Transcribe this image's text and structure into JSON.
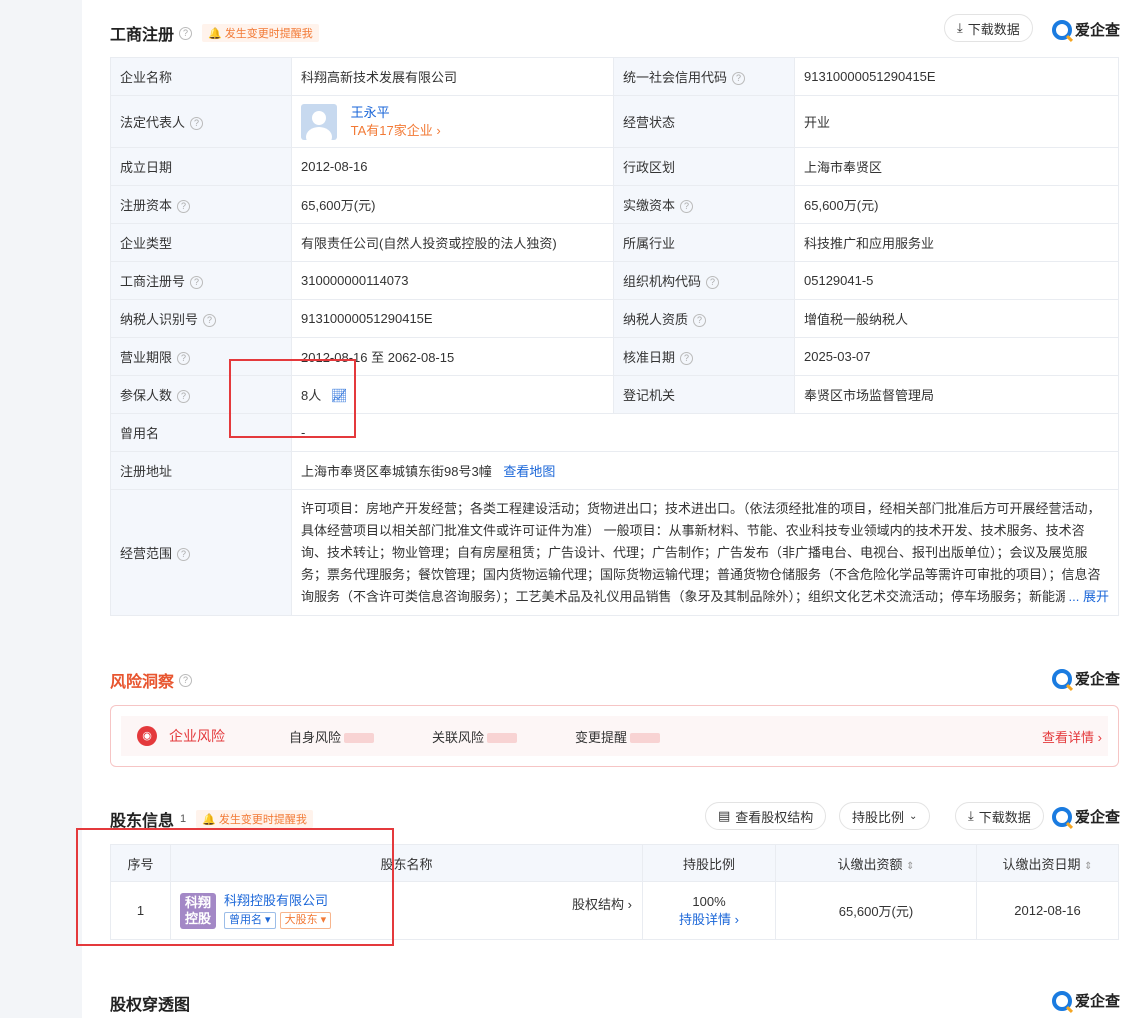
{
  "registration": {
    "title": "工商注册",
    "remind": "发生变更时提醒我",
    "download": "下载数据",
    "brand": "爱企查",
    "rows": {
      "company_name_label": "企业名称",
      "company_name": "科翔高新技术发展有限公司",
      "credit_code_label": "统一社会信用代码",
      "credit_code": "91310000051290415E",
      "legal_rep_label": "法定代表人",
      "legal_rep_name": "王永平",
      "legal_rep_link": "TA有17家企业 ›",
      "status_label": "经营状态",
      "status": "开业",
      "founded_label": "成立日期",
      "founded": "2012-08-16",
      "district_label": "行政区划",
      "district": "上海市奉贤区",
      "reg_capital_label": "注册资本",
      "reg_capital": "65,600万(元)",
      "paid_capital_label": "实缴资本",
      "paid_capital": "65,600万(元)",
      "type_label": "企业类型",
      "type": "有限责任公司(自然人投资或控股的法人独资)",
      "industry_label": "所属行业",
      "industry": "科技推广和应用服务业",
      "reg_no_label": "工商注册号",
      "reg_no": "310000000114073",
      "org_code_label": "组织机构代码",
      "org_code": "05129041-5",
      "tax_id_label": "纳税人识别号",
      "tax_id": "91310000051290415E",
      "tax_qual_label": "纳税人资质",
      "tax_qual": "增值税一般纳税人",
      "term_label": "营业期限",
      "term": "2012-08-16 至 2062-08-15",
      "approve_label": "核准日期",
      "approve": "2025-03-07",
      "insured_label": "参保人数",
      "insured": "8人",
      "authority_label": "登记机关",
      "authority": "奉贤区市场监督管理局",
      "former_label": "曾用名",
      "former": "-",
      "address_label": "注册地址",
      "address": "上海市奉贤区奉城镇东街98号3幢",
      "map_link": "查看地图",
      "scope_label": "经营范围",
      "scope": "许可项目：房地产开发经营；各类工程建设活动；货物进出口；技术进出口。（依法须经批准的项目，经相关部门批准后方可开展经营活动，具体经营项目以相关部门批准文件或许可证件为准） 一般项目：从事新材料、节能、农业科技专业领域内的技术开发、技术服务、技术咨询、技术转让；物业管理；自有房屋租赁；广告设计、代理；广告制作；广告发布（非广播电台、电视台、报刊出版单位）；会议及展览服务；票务代理服务；餐饮管理；国内货物运输代理；国际货物运输代理；普通货物仓储服务（不含危险化学品等需许可审批的项目）；信息咨询服务（不含许可类信息咨询服务）；工艺美术品及礼仪用品销售（象牙及其制品除外）；组织文化艺术交流活动；停车场服务；新能源汽车整车销售；汽车",
      "expand": "... 展开"
    }
  },
  "risk": {
    "title": "风险洞察",
    "brand": "爱企查",
    "label": "企业风险",
    "self": "自身风险",
    "related": "关联风险",
    "change": "变更提醒",
    "detail": "查看详情 ›"
  },
  "shareholders": {
    "title": "股东信息",
    "count": "1",
    "remind": "发生变更时提醒我",
    "equity_structure": "查看股权结构",
    "ratio_dropdown": "持股比例",
    "download": "下载数据",
    "brand": "爱企查",
    "columns": [
      "序号",
      "股东名称",
      "持股比例",
      "认缴出资额",
      "认缴出资日期"
    ],
    "row": {
      "index": "1",
      "logo_line1": "科翔",
      "logo_line2": "控股",
      "name": "科翔控股有限公司",
      "tag_former": "曾用名",
      "tag_major": "大股东",
      "structure_link": "股权结构 ›",
      "ratio": "100%",
      "ratio_detail": "持股详情 ›",
      "amount": "65,600万(元)",
      "date": "2012-08-16"
    }
  },
  "penetration": {
    "title": "股权穿透图",
    "brand": "爱企查"
  }
}
